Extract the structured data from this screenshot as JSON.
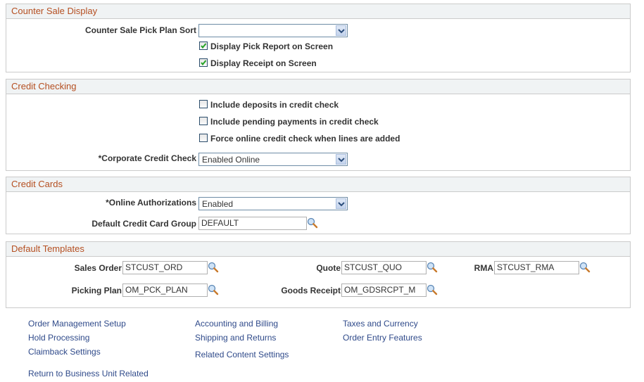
{
  "counter_sale": {
    "title": "Counter Sale Display",
    "pick_plan_sort_label": "Counter Sale Pick Plan Sort",
    "pick_plan_sort_value": "",
    "display_pick_report": {
      "label": "Display Pick Report on Screen",
      "checked": true
    },
    "display_receipt": {
      "label": "Display Receipt on Screen",
      "checked": true
    }
  },
  "credit_checking": {
    "title": "Credit Checking",
    "include_deposits": {
      "label": "Include deposits in credit check",
      "checked": false
    },
    "include_pending": {
      "label": "Include pending payments in credit check",
      "checked": false
    },
    "force_online": {
      "label": "Force online credit check when lines are added",
      "checked": false
    },
    "corporate_label": "*Corporate Credit Check",
    "corporate_value": "Enabled Online"
  },
  "credit_cards": {
    "title": "Credit Cards",
    "online_auth_label": "*Online Authorizations",
    "online_auth_value": "Enabled",
    "card_group_label": "Default Credit Card Group",
    "card_group_value": "DEFAULT"
  },
  "default_templates": {
    "title": "Default Templates",
    "sales_order_label": "Sales Order",
    "sales_order_value": "STCUST_ORD",
    "quote_label": "Quote",
    "quote_value": "STCUST_QUO",
    "rma_label": "RMA",
    "rma_value": "STCUST_RMA",
    "picking_plan_label": "Picking Plan",
    "picking_plan_value": "OM_PCK_PLAN",
    "goods_receipt_label": "Goods Receipt",
    "goods_receipt_value": "OM_GDSRCPT_M"
  },
  "links": {
    "order_management_setup": "Order Management Setup",
    "hold_processing": "Hold Processing",
    "claimback_settings": "Claimback Settings",
    "accounting_billing": "Accounting and Billing",
    "shipping_returns": "Shipping and Returns",
    "related_content": "Related Content Settings",
    "taxes_currency": "Taxes and Currency",
    "order_entry_features": "Order Entry Features",
    "return_bu_related": "Return to Business Unit Related"
  },
  "colors": {
    "section_title": "#b54f21",
    "link": "#2f4a8a",
    "header_bg": "#f0f3f4",
    "border": "#cbcbcb"
  }
}
